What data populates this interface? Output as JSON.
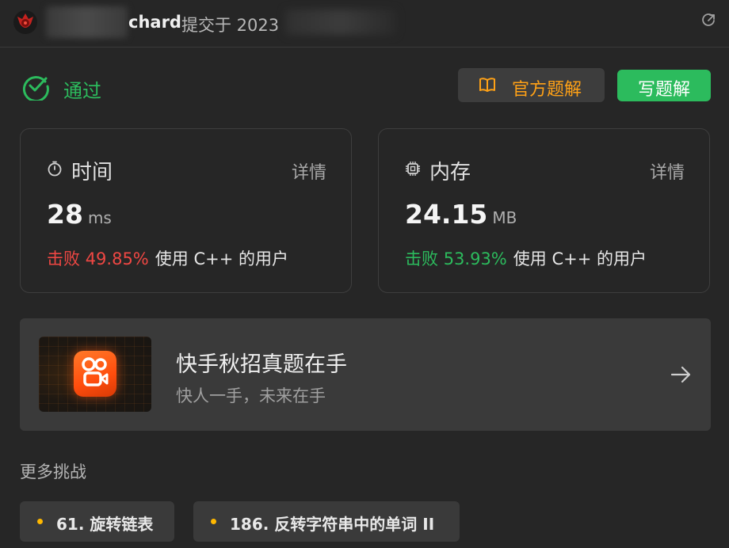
{
  "header": {
    "username_visible": "chard",
    "submitted_text": "提交于 2023"
  },
  "status": {
    "label": "通过",
    "solution_button": "官方题解",
    "write_button": "写题解"
  },
  "time_card": {
    "title": "时间",
    "detail": "详情",
    "value": "28",
    "unit": "ms",
    "beat_word": "击败",
    "beat_percent": "49.85%",
    "beat_rest": "使用 C++ 的用户"
  },
  "memory_card": {
    "title": "内存",
    "detail": "详情",
    "value": "24.15",
    "unit": "MB",
    "beat_word": "击败",
    "beat_percent": "53.93%",
    "beat_rest": "使用 C++ 的用户"
  },
  "banner": {
    "title": "快手秋招真题在手",
    "subtitle": "快人一手，未来在手"
  },
  "more": {
    "title": "更多挑战",
    "items": [
      {
        "label": "61. 旋转链表"
      },
      {
        "label": "186. 反转字符串中的单词 II"
      }
    ]
  },
  "colors": {
    "accept": "#2cbb5d",
    "orange": "#ffa116",
    "beat_bad": "#ef4743",
    "dot": "#ffb800"
  },
  "icons": [
    "avatar-icon",
    "external-link-icon",
    "check-circle-icon",
    "book-icon",
    "stopwatch-icon",
    "chip-icon",
    "kuaishou-logo-icon",
    "arrow-right-icon"
  ]
}
